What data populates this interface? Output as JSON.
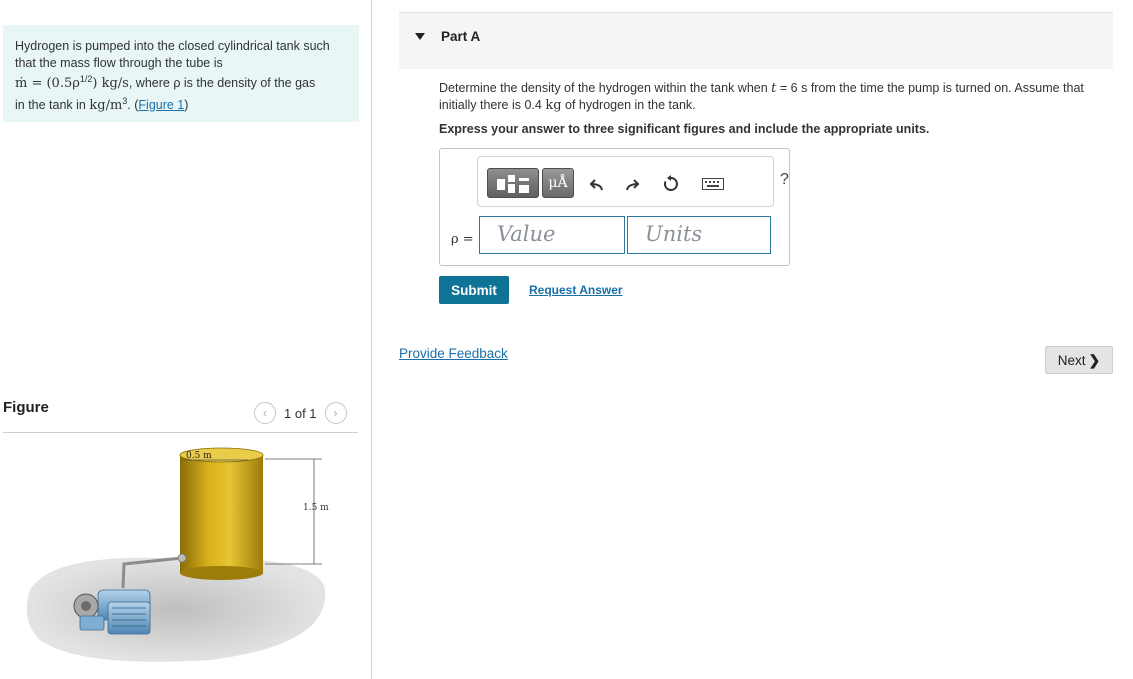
{
  "problem": {
    "line1": "Hydrogen is pumped into the closed cylindrical tank such",
    "line2": "that the mass flow through the tube is",
    "formula": "ṁ = (0.5ρ",
    "formula_exp": "1/2",
    "formula_units": ") kg/s",
    "formula_tail": ", where ρ is the density of the gas",
    "line4_prefix": "in the tank in",
    "units": "kg/m",
    "units_exp": "3",
    "line4_suffix": ". (",
    "figure_link": "Figure 1",
    "close_paren": ")"
  },
  "figure": {
    "title": "Figure",
    "prev_icon": "chevron-left-icon",
    "next_icon": "chevron-right-icon",
    "count": "1 of 1",
    "diameter_label": "0.5 m",
    "height_label": "1.5 m",
    "tank_color": "#d9b21d",
    "pump_color": "#6fa3cc"
  },
  "part": {
    "title": "Part A",
    "question_prefix": "Determine the density of the hydrogen within the tank when",
    "question_t": "t",
    "question_eq": "= 6",
    "question_s": "s",
    "question_mid": "from the time the pump is turned on. Assume that",
    "question_line2_prefix": "initially there is 0.4",
    "question_kg": "kg",
    "question_line2_suffix": "of hydrogen in the tank.",
    "instruction": "Express your answer to three significant figures and include the appropriate units."
  },
  "toolbar": {
    "templates_icon": "templates-icon",
    "units_button": "μÅ",
    "undo_icon": "undo-icon",
    "redo_icon": "redo-icon",
    "reset_icon": "reset-icon",
    "keyboard_icon": "keyboard-icon",
    "help": "?"
  },
  "answer": {
    "label": "ρ =",
    "value_placeholder": "Value",
    "units_placeholder": "Units"
  },
  "actions": {
    "submit": "Submit",
    "request_answer": "Request Answer",
    "provide_feedback": "Provide Feedback",
    "next": "Next",
    "next_icon": "chevron-right-icon"
  },
  "colors": {
    "accent": "#0f7396",
    "link": "#1a6fa8",
    "problem_bg": "#e8f6f6"
  }
}
